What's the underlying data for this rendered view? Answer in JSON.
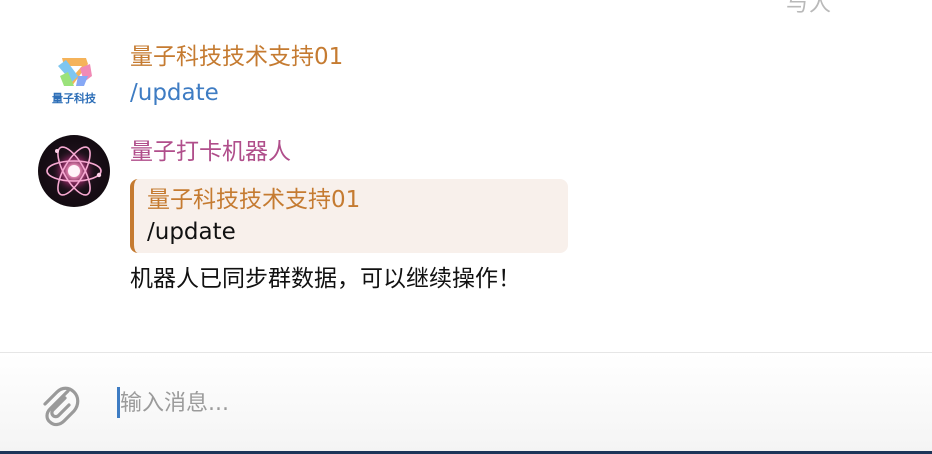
{
  "header": {
    "clipped_text": "与人"
  },
  "messages": [
    {
      "sender": "量子科技技术支持01",
      "text": "/update",
      "avatar_icon": "quantum-tech-logo-icon",
      "avatar_label": "量子科技"
    },
    {
      "sender": "量子打卡机器人",
      "avatar_icon": "atom-icon",
      "quote": {
        "sender": "量子科技技术支持01",
        "text": "/update"
      },
      "text": "机器人已同步群数据，可以继续操作！"
    }
  ],
  "composer": {
    "placeholder": "输入消息...",
    "attach_icon": "paperclip-icon"
  },
  "colors": {
    "orange_sender": "#c57b31",
    "pink_sender": "#b04e8b",
    "link_blue": "#3e7cc3",
    "quote_bg": "#f8f0eb"
  }
}
